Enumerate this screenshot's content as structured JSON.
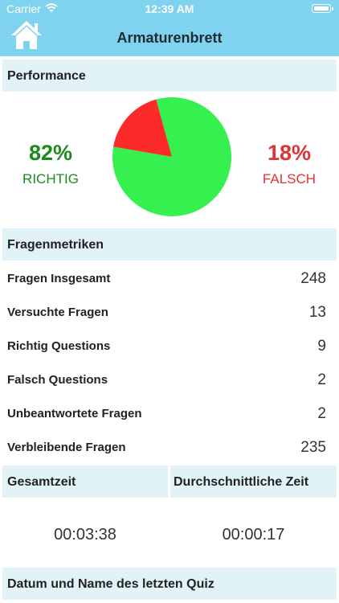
{
  "status_bar": {
    "carrier": "Carrier",
    "time": "12:39 AM"
  },
  "nav": {
    "title": "Armaturenbrett",
    "home_icon": "home-icon"
  },
  "performance": {
    "header": "Performance",
    "correct_percent": "82%",
    "correct_label": "RICHTIG",
    "wrong_percent": "18%",
    "wrong_label": "FALSCH",
    "correct_color": "#1c8a1c",
    "wrong_color": "#e03434"
  },
  "chart_data": {
    "type": "pie",
    "categories": [
      "RICHTIG",
      "FALSCH"
    ],
    "values": [
      82,
      18
    ],
    "colors": [
      "#35f04f",
      "#fd2a2a"
    ],
    "title": ""
  },
  "metrics": {
    "header": "Fragenmetriken",
    "rows": [
      {
        "label": "Fragen Insgesamt",
        "value": "248"
      },
      {
        "label": "Versuchte Fragen",
        "value": "13"
      },
      {
        "label": "Richtig Questions",
        "value": "9"
      },
      {
        "label": "Falsch Questions",
        "value": "2"
      },
      {
        "label": "Unbeantwortete Fragen",
        "value": "2"
      },
      {
        "label": "Verbleibende Fragen",
        "value": "235"
      }
    ]
  },
  "times": {
    "total_label": "Gesamtzeit",
    "average_label": "Durchschnittliche Zeit",
    "total_value": "00:03:38",
    "average_value": "00:00:17"
  },
  "last_quiz": {
    "header": "Datum und Name des letzten Quiz"
  },
  "colors": {
    "accent": "#7fd3ef",
    "section_bg": "#e2f3f7"
  }
}
